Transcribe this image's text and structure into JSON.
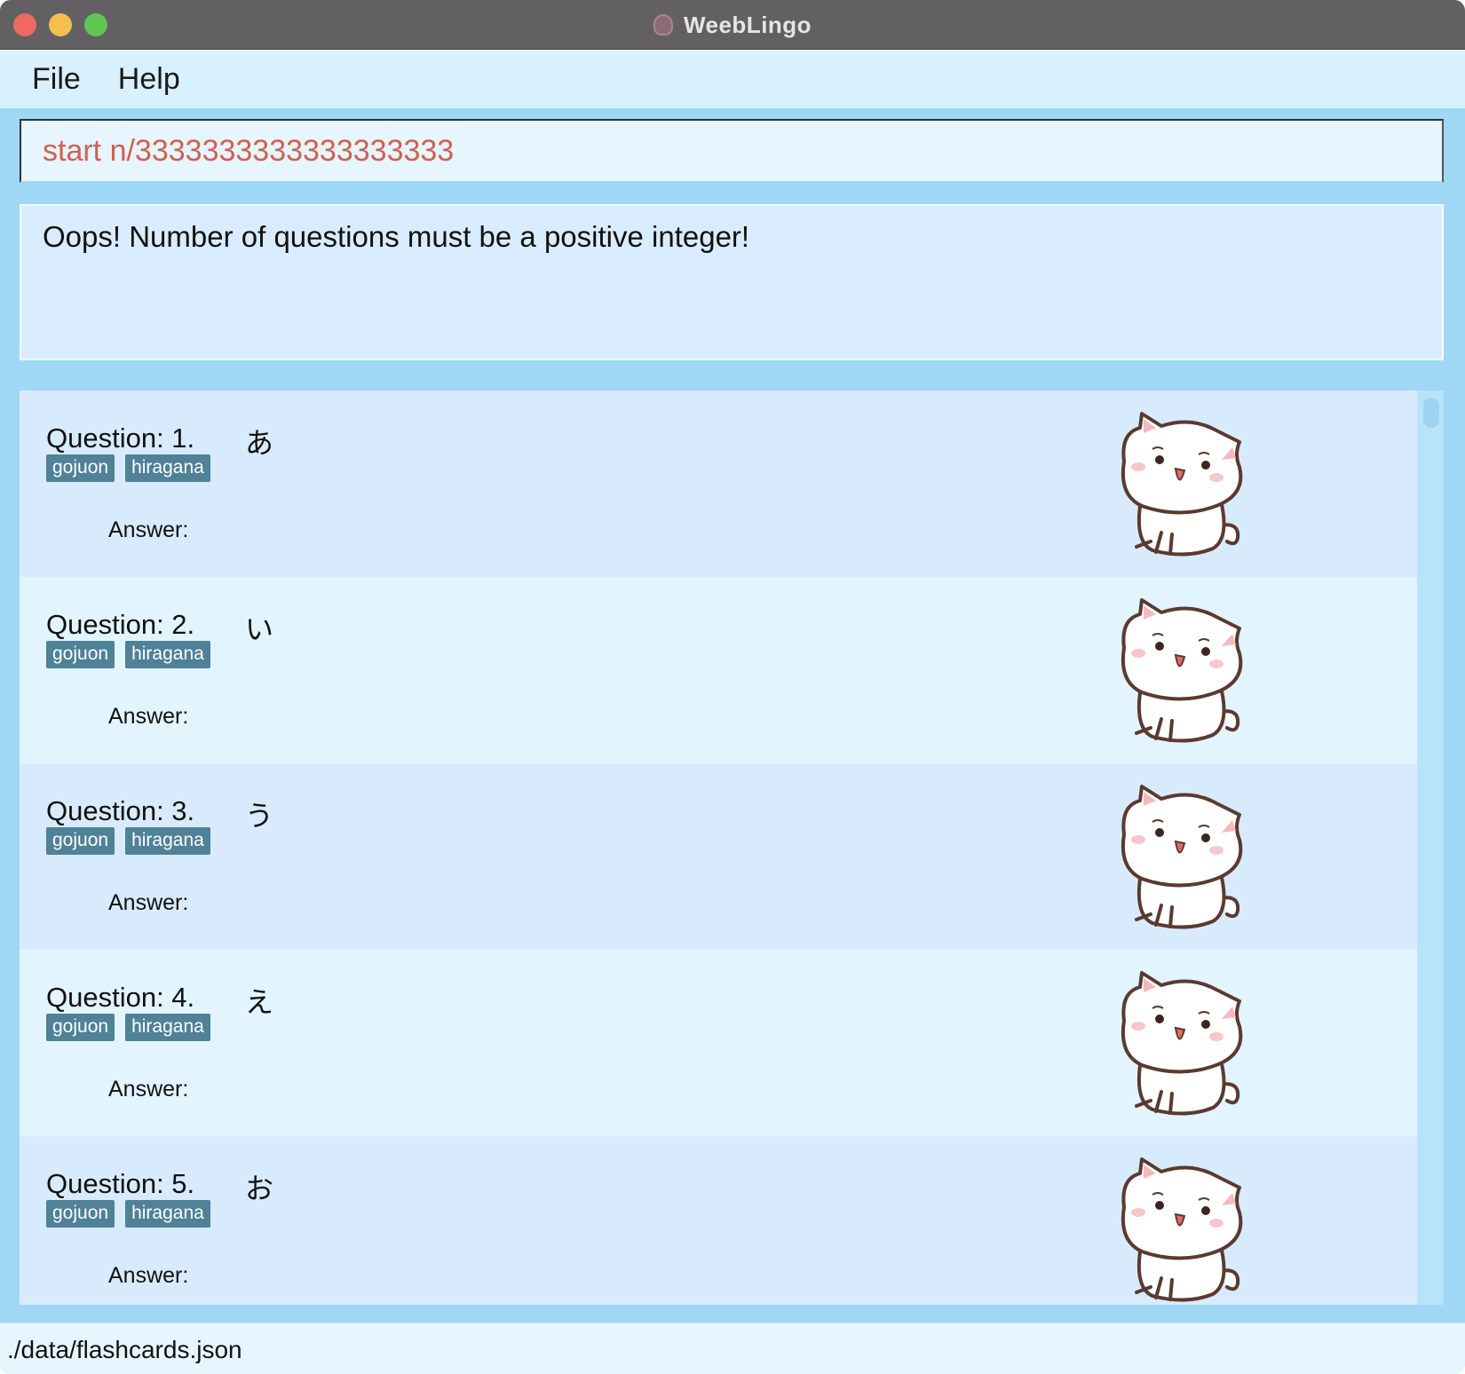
{
  "window": {
    "title": "WeebLingo",
    "logo_icon": "weeblingo-logo-icon"
  },
  "menu": {
    "items": [
      {
        "label": "File"
      },
      {
        "label": "Help"
      }
    ]
  },
  "command_box": {
    "value": "start n/3333333333333333333",
    "text_color": "#d2604f"
  },
  "result_display": {
    "message": "Oops! Number of questions must be a positive integer!"
  },
  "flashcards": [
    {
      "label": "Question: 1.",
      "kana": "あ",
      "tags": [
        "gojuon",
        "hiragana"
      ],
      "answer_label": "Answer:",
      "image_icon": "cat-mascot-icon"
    },
    {
      "label": "Question: 2.",
      "kana": "い",
      "tags": [
        "gojuon",
        "hiragana"
      ],
      "answer_label": "Answer:",
      "image_icon": "cat-mascot-icon"
    },
    {
      "label": "Question: 3.",
      "kana": "う",
      "tags": [
        "gojuon",
        "hiragana"
      ],
      "answer_label": "Answer:",
      "image_icon": "cat-mascot-icon"
    },
    {
      "label": "Question: 4.",
      "kana": "え",
      "tags": [
        "gojuon",
        "hiragana"
      ],
      "answer_label": "Answer:",
      "image_icon": "cat-mascot-icon"
    },
    {
      "label": "Question: 5.",
      "kana": "お",
      "tags": [
        "gojuon",
        "hiragana"
      ],
      "answer_label": "Answer:",
      "image_icon": "cat-mascot-icon"
    }
  ],
  "status_bar": {
    "file_path": "./data/flashcards.json"
  },
  "colors": {
    "background": "#9ed8f5",
    "tag_background": "#4f8197",
    "card_odd": "#d8ebfd",
    "card_even": "#e2f4fe"
  }
}
